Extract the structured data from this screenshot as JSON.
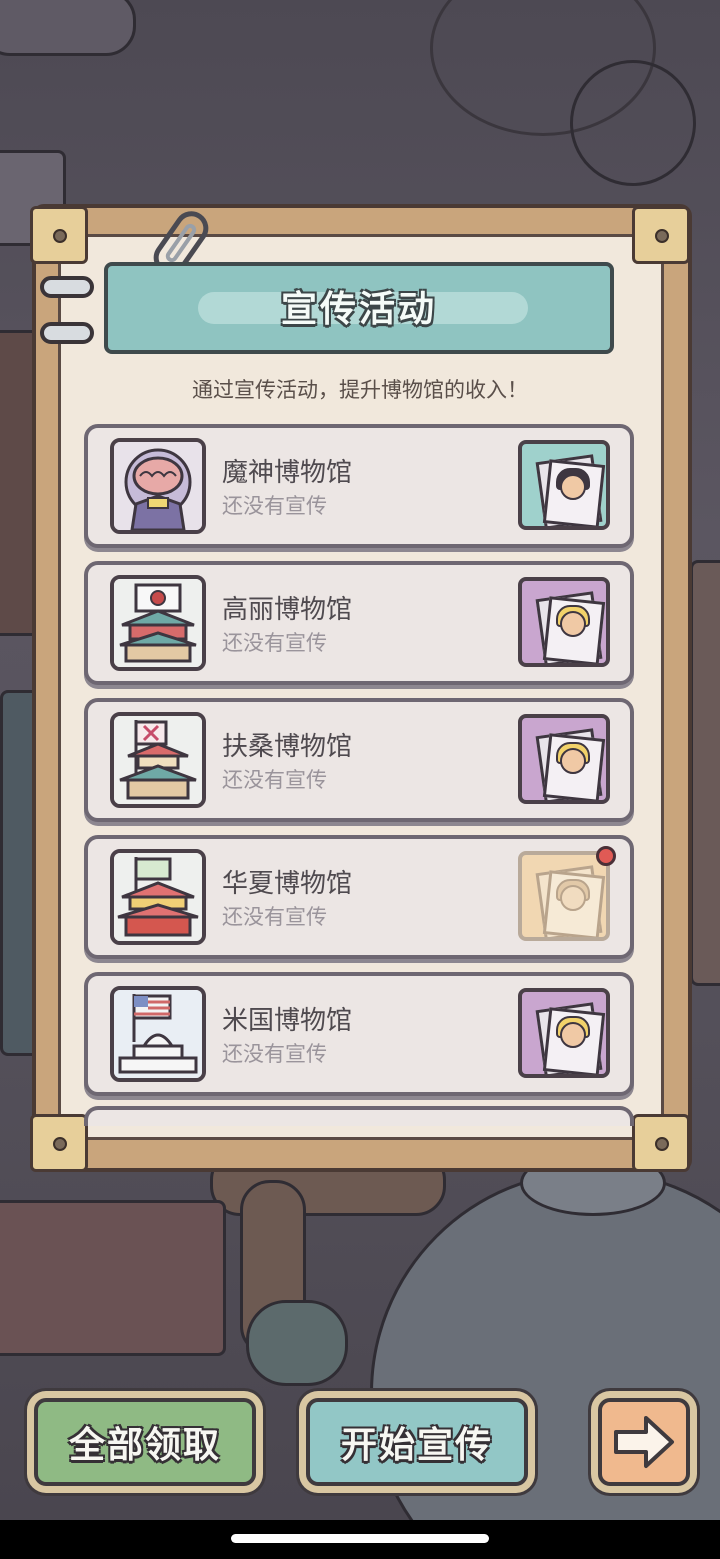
{
  "panel": {
    "title": "宣传活动",
    "subtitle": "通过宣传活动，提升博物馆的收入！"
  },
  "museums": [
    {
      "name": "魔神博物馆",
      "status": "还没有宣传",
      "thumb_icon": "demon-museum-icon",
      "poster_icon": "poster-masked-woman-icon",
      "poster_color": "#9fd1cc",
      "has_alert": false
    },
    {
      "name": "高丽博物馆",
      "status": "还没有宣传",
      "thumb_icon": "korea-museum-icon",
      "poster_icon": "poster-blonde-woman-icon",
      "poster_color": "#c9a6cf",
      "has_alert": false
    },
    {
      "name": "扶桑博物馆",
      "status": "还没有宣传",
      "thumb_icon": "japan-museum-icon",
      "poster_icon": "poster-blonde-woman-icon",
      "poster_color": "#c9a6cf",
      "has_alert": false
    },
    {
      "name": "华夏博物馆",
      "status": "还没有宣传",
      "thumb_icon": "china-museum-icon",
      "poster_icon": "poster-sketch-woman-icon",
      "poster_color": "#f1d7b2",
      "has_alert": true
    },
    {
      "name": "米国博物馆",
      "status": "还没有宣传",
      "thumb_icon": "usa-museum-icon",
      "poster_icon": "poster-blonde-woman-icon",
      "poster_color": "#c9a6cf",
      "has_alert": false
    }
  ],
  "buttons": {
    "claim_all": "全部领取",
    "start_promo": "开始宣传",
    "next_icon": "arrow-right-icon"
  },
  "colors": {
    "header_teal": "#8fc4c1",
    "claim_green": "#8fba84",
    "promo_teal": "#92c7c6",
    "next_orange": "#f0b98e",
    "alert_red": "#e05a55"
  }
}
